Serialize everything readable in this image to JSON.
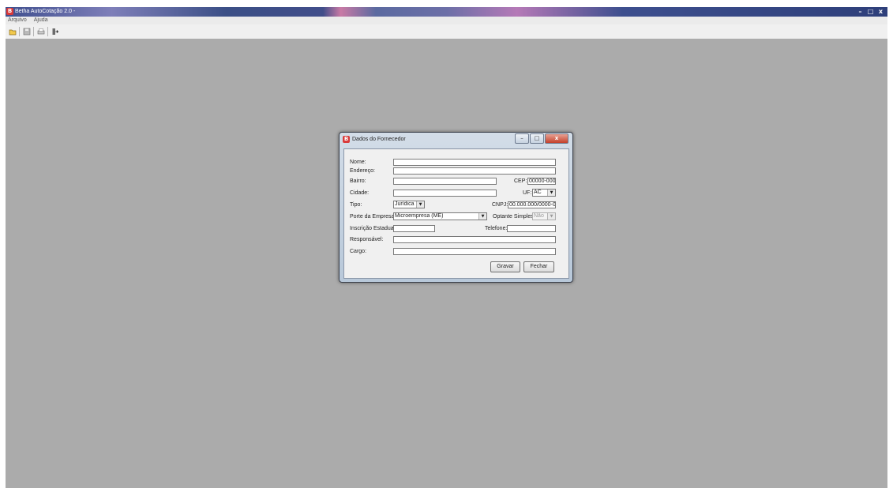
{
  "app": {
    "icon_letter": "B",
    "title": "Betha AutoCotação 2.0 -",
    "window_buttons": {
      "minimize": "–",
      "maximize": "□",
      "close": "x"
    }
  },
  "menu": {
    "items": [
      "Arquivo",
      "Ajuda"
    ]
  },
  "toolbar": {
    "icons": [
      "open-folder-icon",
      "save-icon",
      "print-icon",
      "exit-icon"
    ]
  },
  "dialog": {
    "icon_letter": "B",
    "title": "Dados do Fornecedor",
    "buttons": {
      "minimize": "–",
      "maximize": "□",
      "close": "x"
    },
    "fields": {
      "nome": {
        "label": "Nome:",
        "value": ""
      },
      "endereco": {
        "label": "Endereço:",
        "value": ""
      },
      "bairro": {
        "label": "Bairro:",
        "value": ""
      },
      "cep": {
        "label": "CEP:",
        "value": "00000-000"
      },
      "cidade": {
        "label": "Cidade:",
        "value": ""
      },
      "uf": {
        "label": "UF:",
        "value": "AC"
      },
      "tipo": {
        "label": "Tipo:",
        "value": "Jurídica"
      },
      "cnpj": {
        "label": "CNPJ:",
        "value": "00.000.000/0000-00"
      },
      "porte": {
        "label": "Porte da Empresa:",
        "value": "Microempresa (ME)"
      },
      "optante": {
        "label": "Optante Simples:",
        "value": "Não"
      },
      "inscricao": {
        "label": "Inscrição Estadual:",
        "value": ""
      },
      "telefone": {
        "label": "Telefone:",
        "value": ""
      },
      "responsavel": {
        "label": "Responsável:",
        "value": ""
      },
      "cargo": {
        "label": "Cargo:",
        "value": ""
      }
    },
    "actions": {
      "save": "Gravar",
      "close": "Fechar"
    }
  }
}
